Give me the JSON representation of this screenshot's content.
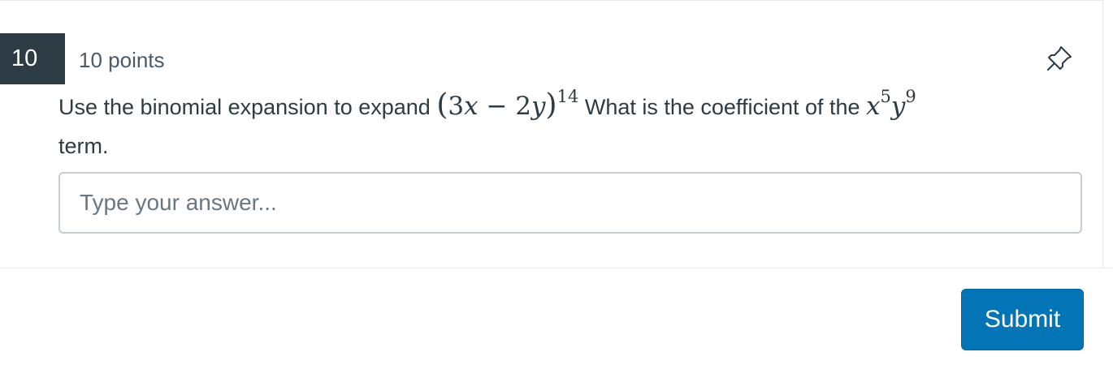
{
  "question": {
    "number": "10",
    "points": "10 points",
    "text_before": "Use the binomial expansion to expand",
    "math_expression": {
      "open_paren": "(",
      "term1_coef": "3",
      "term1_var": "x",
      "operator": "−",
      "term2_coef": "2",
      "term2_var": "y",
      "close_paren": ")",
      "exponent": "14"
    },
    "text_middle": "What is the coefficient of the",
    "math_term": {
      "var1": "x",
      "exp1": "5",
      "var2": "y",
      "exp2": "9"
    },
    "text_after": "term."
  },
  "answer": {
    "placeholder": "Type your answer...",
    "value": ""
  },
  "actions": {
    "submit_label": "Submit"
  },
  "icons": {
    "pin": "pin-icon"
  },
  "colors": {
    "number_badge_bg": "#2d3b45",
    "submit_bg": "#0374b5",
    "text": "#2d3b45"
  }
}
